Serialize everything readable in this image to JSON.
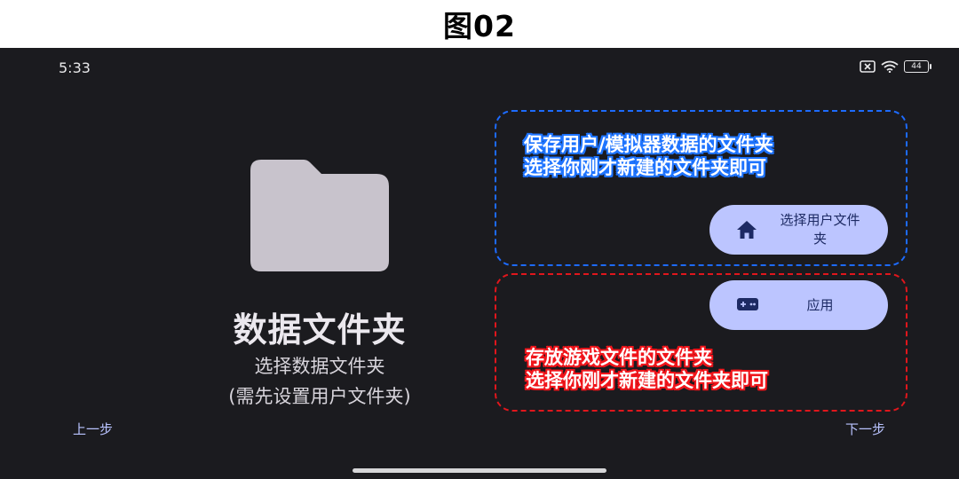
{
  "caption": "图02",
  "status_bar": {
    "time": "5:33",
    "battery_level": "44"
  },
  "main": {
    "title": "数据文件夹",
    "subtitle": "选择数据文件夹",
    "subtitle2": "(需先设置用户文件夹)"
  },
  "buttons": {
    "select_user_folder": {
      "label_line1": "选择用户文件",
      "label_line2": "夹",
      "icon": "home-icon"
    },
    "app": {
      "label": "应用",
      "icon": "gamepad-icon"
    }
  },
  "navigation": {
    "prev_label": "上一步",
    "next_label": "下一步"
  },
  "annotations": {
    "blue": {
      "line1": "保存用户/模拟器数据的文件夹",
      "line2": "选择你刚才新建的文件夹即可",
      "color": "#1d6bff"
    },
    "red": {
      "line1": "存放游戏文件的文件夹",
      "line2": "选择你刚才新建的文件夹即可",
      "color": "#e0161c"
    }
  },
  "colors": {
    "background": "#1b1b1f",
    "pill": "#bcc5ff",
    "pill_text": "#1d2a63",
    "folder": "#c8c3cc",
    "link": "#b9c3ff"
  }
}
